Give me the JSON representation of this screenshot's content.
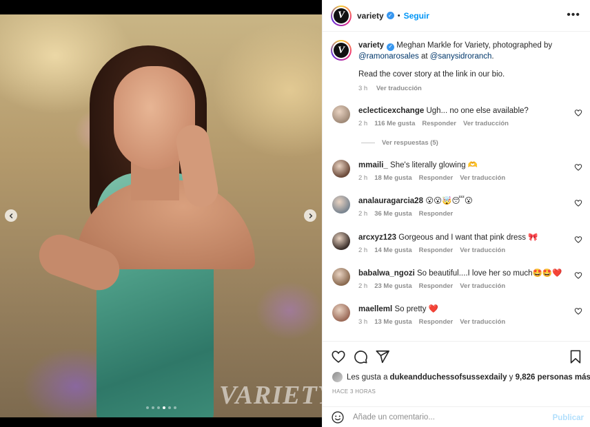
{
  "post": {
    "username": "variety",
    "avatar_letter": "V",
    "follow_label": "Seguir",
    "separator": "•",
    "more_label": "•••",
    "watermark": "VARIETY"
  },
  "caption": {
    "username": "variety",
    "line1": " Meghan Markle for Variety, photographed by ",
    "mention1": "@ramonarosales",
    "at": " at ",
    "mention2": "@sanysidroranch",
    "end": ".",
    "line2": "Read the cover story at the link in our bio.",
    "time": "3 h",
    "translate": "Ver traducción"
  },
  "comments": [
    {
      "user": "eclecticexchange",
      "text": "Ugh... no one else available?",
      "time": "2 h",
      "likes": "116 Me gusta",
      "reply": "Responder",
      "translate": "Ver traducción",
      "avatar_color": "#a08a78"
    },
    {
      "user": "mmaili_",
      "text": "She's literally glowing 🫶",
      "time": "2 h",
      "likes": "18 Me gusta",
      "reply": "Responder",
      "translate": "Ver traducción",
      "avatar_color": "#6b4a3a"
    },
    {
      "user": "analauragarcia28",
      "text": "😮😮🤯😴😮",
      "time": "2 h",
      "likes": "36 Me gusta",
      "reply": "Responder",
      "translate": "",
      "avatar_color": "#7a8590"
    },
    {
      "user": "arcxyz123",
      "text": "Gorgeous and I want that pink dress 🎀",
      "time": "2 h",
      "likes": "14 Me gusta",
      "reply": "Responder",
      "translate": "Ver traducción",
      "avatar_color": "#3b2f2a"
    },
    {
      "user": "babalwa_ngozi",
      "text": "So beautiful....I love her so much🤩🤩❤️",
      "time": "2 h",
      "likes": "23 Me gusta",
      "reply": "Responder",
      "translate": "Ver traducción",
      "avatar_color": "#8a6a50"
    },
    {
      "user": "maelleml",
      "text": "So pretty ❤️",
      "time": "3 h",
      "likes": "13 Me gusta",
      "reply": "Responder",
      "translate": "Ver traducción",
      "avatar_color": "#9b6a58"
    }
  ],
  "view_replies": "Ver respuestas (5)",
  "likes_line": {
    "prefix": "Les gusta a ",
    "user": "dukeandduchessofsussexdaily",
    "middle": " y ",
    "count": "9,826 personas más"
  },
  "time_ago": "HACE 3 HORAS",
  "comment_box": {
    "placeholder": "Añade un comentario...",
    "publish": "Publicar"
  },
  "carousel": {
    "total": 6,
    "active_index": 3
  },
  "colors": {
    "accent": "#0095f6",
    "verified": "#3897f0",
    "link": "#00376b",
    "muted": "#8e8e8e"
  }
}
